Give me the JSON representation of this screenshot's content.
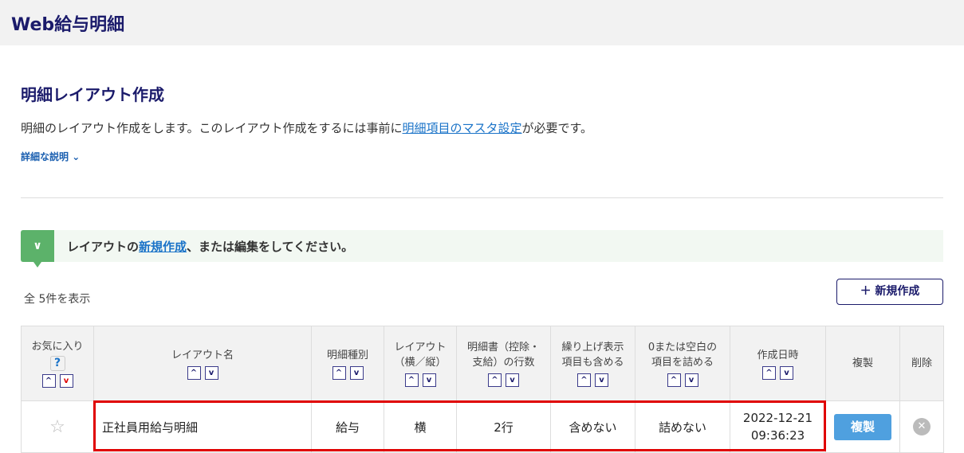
{
  "app": {
    "title": "Web給与明細"
  },
  "page": {
    "title": "明細レイアウト作成",
    "description_before": "明細のレイアウト作成をします。このレイアウト作成をするには事前に",
    "description_link": "明細項目のマスタ設定",
    "description_after": "が必要です。",
    "details_label": "詳細な説明"
  },
  "banner": {
    "before": "レイアウトの",
    "link": "新規作成",
    "after": "、または編集をしてください。"
  },
  "count_label": "全 5件を表示",
  "new_button": "＋ 新規作成",
  "table": {
    "headers": [
      "お気に入り",
      "レイアウト名",
      "明細種別",
      "レイアウト\n（横／縦）",
      "明細書（控除・\n支給）の行数",
      "繰り上げ表示\n項目も含める",
      "0または空白の\n項目を詰める",
      "作成日時",
      "複製",
      "削除"
    ],
    "rows": [
      {
        "name": "正社員用給与明細",
        "type": "給与",
        "layout": "横",
        "lines": "2行",
        "carry": "含めない",
        "blank": "詰めない",
        "date": "2022-12-21",
        "time": "09:36:23",
        "copy": "複製"
      }
    ]
  },
  "colors": {
    "navy": "#1b1b6b",
    "accent_green": "#5cb26a",
    "copy_blue": "#4fa0df",
    "highlight": "#e00000"
  }
}
